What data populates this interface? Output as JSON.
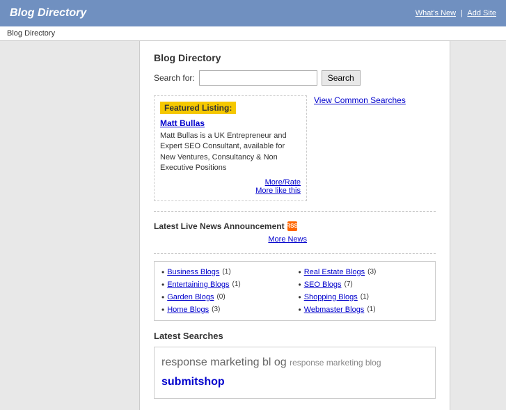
{
  "header": {
    "title": "Blog Directory",
    "whats_new": "What's New",
    "sep": "|",
    "add_site": "Add Site"
  },
  "breadcrumb": "Blog Directory",
  "main": {
    "title": "Blog Directory",
    "search_label": "Search for:",
    "search_placeholder": "",
    "search_button": "Search",
    "view_common_searches": "View Common Searches",
    "featured": {
      "label": "Featured Listing:",
      "name": "Matt Bullas",
      "description": "Matt Bullas is a UK Entrepreneur and Expert SEO Consultant, available for New Ventures, Consultancy & Non Executive Positions",
      "more_rate": "More/Rate",
      "more_like": "More like this"
    },
    "news": {
      "title": "Latest Live News Announcement",
      "more_news": "More News"
    },
    "categories": [
      {
        "name": "Business Blogs",
        "count": "(1)"
      },
      {
        "name": "Real Estate Blogs",
        "count": "(3)"
      },
      {
        "name": "Entertaining Blogs",
        "count": "(1)"
      },
      {
        "name": "SEO Blogs",
        "count": "(7)"
      },
      {
        "name": "Garden Blogs",
        "count": "(0)"
      },
      {
        "name": "Shopping Blogs",
        "count": "(1)"
      },
      {
        "name": "Home Blogs",
        "count": "(3)"
      },
      {
        "name": "Webmaster Blogs",
        "count": "(1)"
      }
    ],
    "latest_searches_title": "Latest Searches",
    "search_terms": [
      {
        "text": "response",
        "size": "large",
        "color": "gray"
      },
      {
        "text": "marketing",
        "size": "large",
        "color": "gray"
      },
      {
        "text": "bl og",
        "size": "large",
        "color": "gray"
      },
      {
        "text": "response",
        "size": "medium",
        "color": "gray"
      },
      {
        "text": "marketing",
        "size": "medium",
        "color": "gray"
      },
      {
        "text": "blog",
        "size": "medium",
        "color": "gray"
      },
      {
        "text": "submitshop",
        "size": "large",
        "color": "blue"
      }
    ]
  }
}
